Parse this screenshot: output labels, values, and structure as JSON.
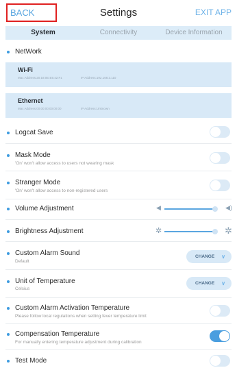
{
  "header": {
    "back_label": "BACK",
    "title": "Settings",
    "exit_label": "EXIT APP"
  },
  "tabs": [
    {
      "label": "System",
      "active": true
    },
    {
      "label": "Connectivity",
      "active": false
    },
    {
      "label": "Device Information",
      "active": false
    }
  ],
  "network": {
    "section_label": "NetWork",
    "wifi": {
      "name": "Wi-Fi",
      "mac": "Mac Address:20:18:0E:E5:42:F1",
      "ip": "IP Address:192.168.3.110"
    },
    "ethernet": {
      "name": "Ethernet",
      "mac": "Mac Address:00:00:00:00:00:00",
      "ip": "IP Address:Unknown"
    }
  },
  "settings": {
    "logcat": {
      "label": "Logcat Save",
      "enabled": false
    },
    "mask": {
      "label": "Mask Mode",
      "sub": "'On' won't allow access to users not wearing mask",
      "enabled": false
    },
    "stranger": {
      "label": "Stranger Mode",
      "sub": "'On' won't allow access to non-registered users",
      "enabled": false
    },
    "volume": {
      "label": "Volume Adjustment",
      "level": 1.0
    },
    "brightness": {
      "label": "Brightness Adjustment",
      "level": 1.0
    },
    "alarm_sound": {
      "label": "Custom Alarm Sound",
      "sub": "Default",
      "button": "CHANGE"
    },
    "temp_unit": {
      "label": "Unit of Temperature",
      "sub": "Celsius",
      "button": "CHANGE"
    },
    "alarm_temp": {
      "label": "Custom Alarm Activation Temperature",
      "sub": "Please follow local regulations when setting fever temperature limit",
      "enabled": false
    },
    "compensation": {
      "label": "Compensation Temperature",
      "sub": "For manually entering temperature adjustment during calibration",
      "enabled": true
    },
    "test_mode": {
      "label": "Test Mode",
      "enabled": false
    }
  },
  "colors": {
    "accent": "#4a9edf",
    "highlight_border": "#e02020",
    "card_bg": "#d8e9f7"
  }
}
